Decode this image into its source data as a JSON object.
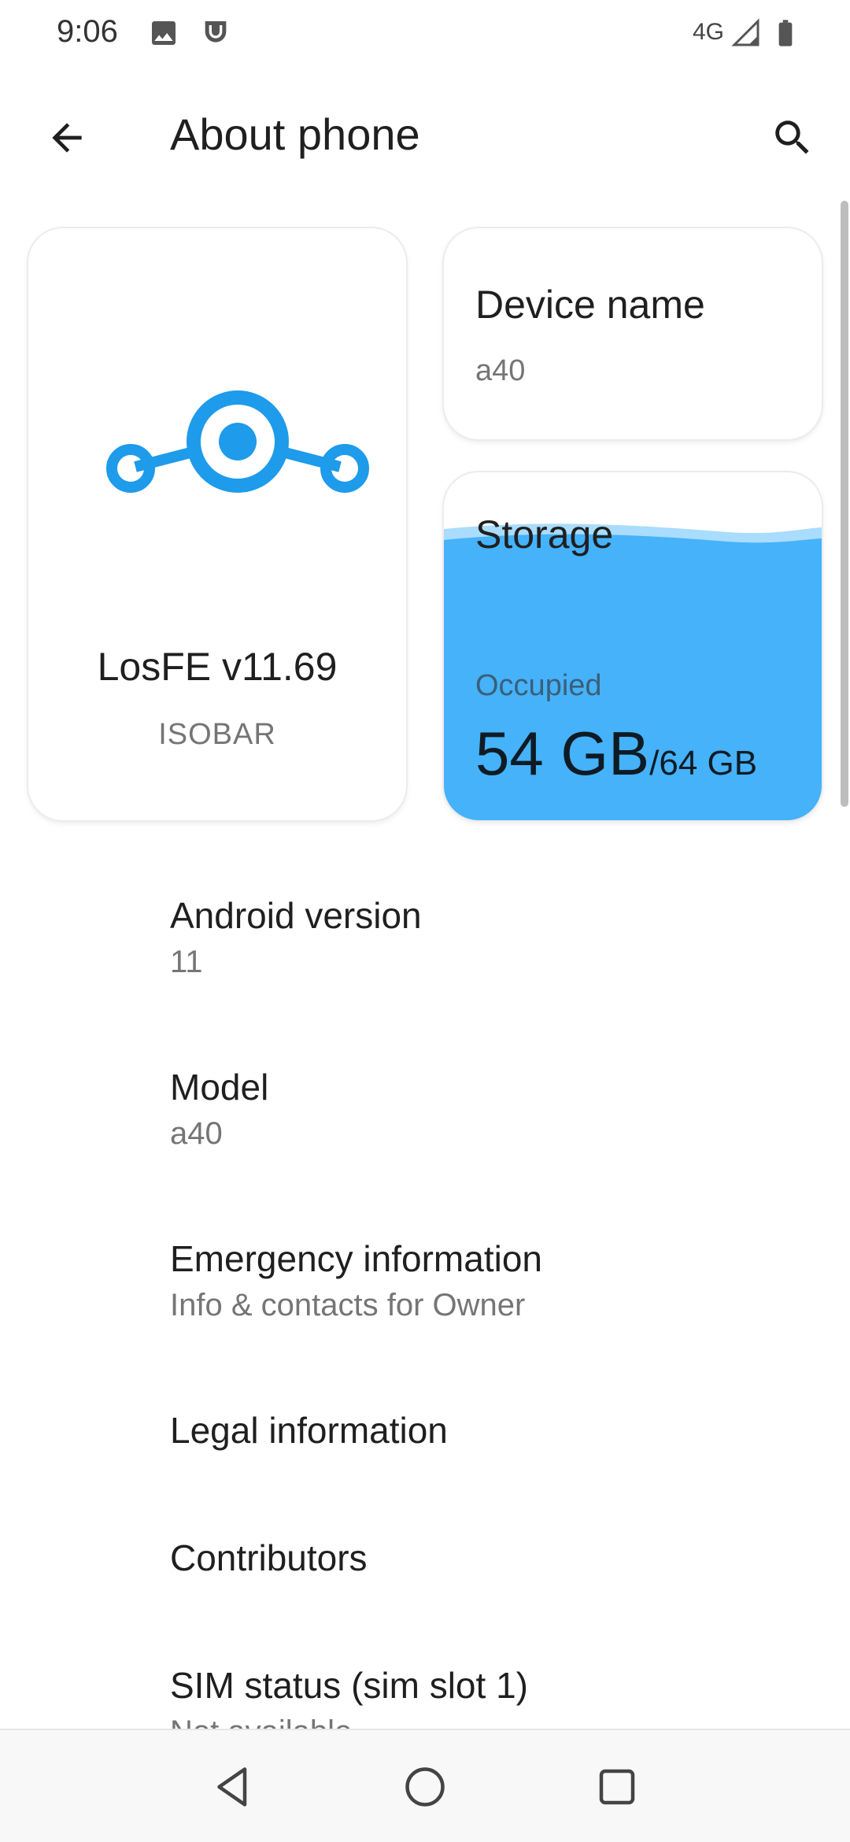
{
  "status_bar": {
    "time": "9:06",
    "network": "4G",
    "icons": [
      "image-icon",
      "alarm-icon",
      "signal-icon",
      "battery-icon"
    ]
  },
  "app_bar": {
    "title": "About phone",
    "back_icon": "back-arrow-icon",
    "search_icon": "search-icon"
  },
  "os_card": {
    "name": "LosFE v11.69",
    "subtitle": "ISOBAR",
    "logo": "lineage-logo-icon",
    "accent": "#1e9bea"
  },
  "device_card": {
    "title": "Device name",
    "value": "a40"
  },
  "storage_card": {
    "title": "Storage",
    "label": "Occupied",
    "used": "54 GB",
    "total": "/64 GB",
    "fill_fraction": 0.84,
    "fill_color": "#45b2fa"
  },
  "preferences": [
    {
      "title": "Android version",
      "summary": "11"
    },
    {
      "title": "Model",
      "summary": "a40"
    },
    {
      "title": "Emergency information",
      "summary": "Info & contacts for Owner"
    },
    {
      "title": "Legal information",
      "summary": ""
    },
    {
      "title": "Contributors",
      "summary": ""
    },
    {
      "title": "SIM status (sim slot 1)",
      "summary": "Not available"
    }
  ],
  "nav_bar": {
    "icons": [
      "nav-back-icon",
      "nav-home-icon",
      "nav-recents-icon"
    ]
  }
}
